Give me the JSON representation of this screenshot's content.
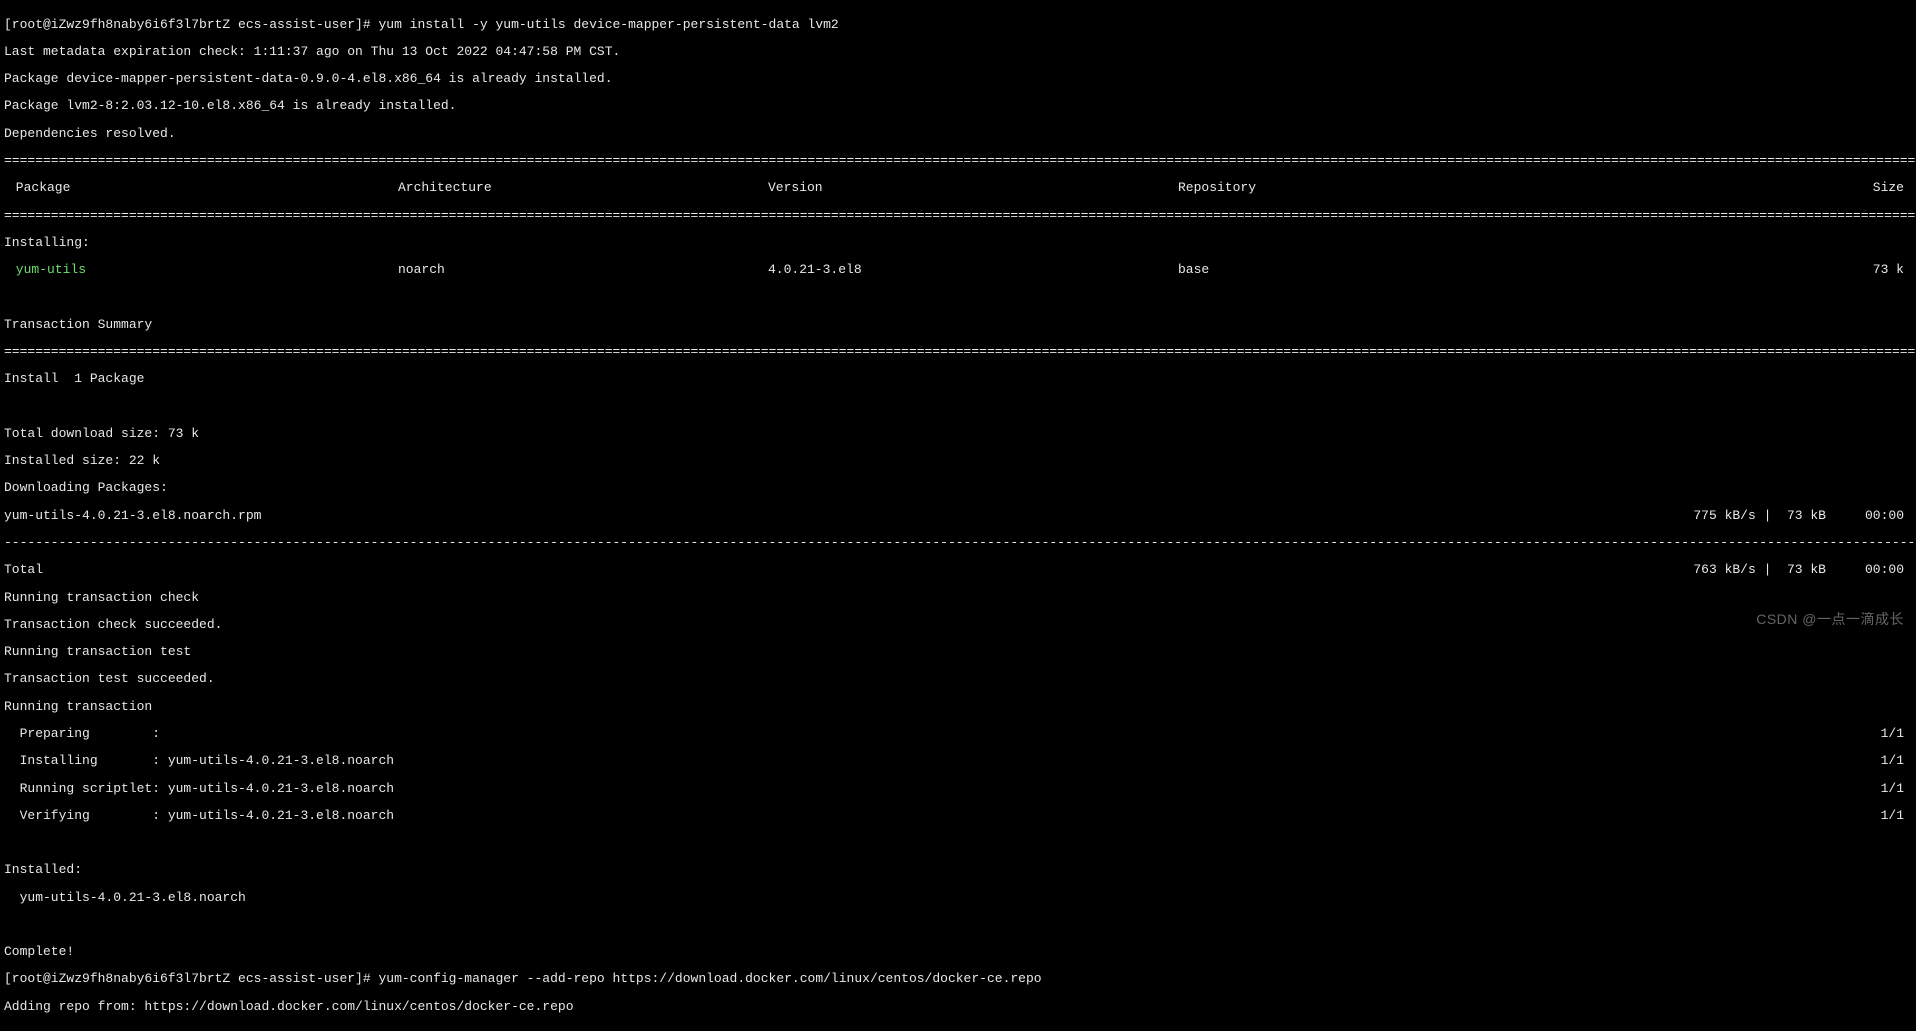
{
  "prompt1": "[root@iZwz9fh8naby6i6f3l7brtZ ecs-assist-user]# yum install -y yum-utils device-mapper-persistent-data lvm2",
  "meta_check": "Last metadata expiration check: 1:11:37 ago on Thu 13 Oct 2022 04:47:58 PM CST.",
  "already1": "Package device-mapper-persistent-data-0.9.0-4.el8.x86_64 is already installed.",
  "already2": "Package lvm2-8:2.03.12-10.el8.x86_64 is already installed.",
  "deps_resolved": "Dependencies resolved.",
  "headers": {
    "package": " Package",
    "arch": "Architecture",
    "version": "Version",
    "repo": "Repository",
    "size": "Size"
  },
  "installing_hdr": "Installing:",
  "row": {
    "package": " yum-utils",
    "arch": "noarch",
    "version": "4.0.21-3.el8",
    "repo": "base",
    "size": "73 k"
  },
  "tx_summary": "Transaction Summary",
  "install_count": "Install  1 Package",
  "dl_size": "Total download size: 73 k",
  "inst_size": "Installed size: 22 k",
  "dl_pkgs": "Downloading Packages:",
  "rpm_line_left": "yum-utils-4.0.21-3.el8.noarch.rpm",
  "rpm_line_right": "775 kB/s |  73 kB     00:00",
  "total_left": "Total",
  "total_right": "763 kB/s |  73 kB     00:00",
  "tx_check": "Running transaction check",
  "tx_check_ok": "Transaction check succeeded.",
  "tx_test": "Running transaction test",
  "tx_test_ok": "Transaction test succeeded.",
  "tx_run": "Running transaction",
  "step_prepare": "  Preparing        :",
  "step_install": "  Installing       : yum-utils-4.0.21-3.el8.noarch",
  "step_scriptlet": "  Running scriptlet: yum-utils-4.0.21-3.el8.noarch",
  "step_verify": "  Verifying        : yum-utils-4.0.21-3.el8.noarch",
  "step_ratio": "1/1",
  "installed_hdr": "Installed:",
  "installed_pkg": "  yum-utils-4.0.21-3.el8.noarch",
  "complete": "Complete!",
  "prompt2": "[root@iZwz9fh8naby6i6f3l7brtZ ecs-assist-user]# yum-config-manager --add-repo https://download.docker.com/linux/centos/docker-ce.repo",
  "adding_repo": "Adding repo from: https://download.docker.com/linux/centos/docker-ce.repo",
  "watermark": "CSDN @一点一滴成长"
}
